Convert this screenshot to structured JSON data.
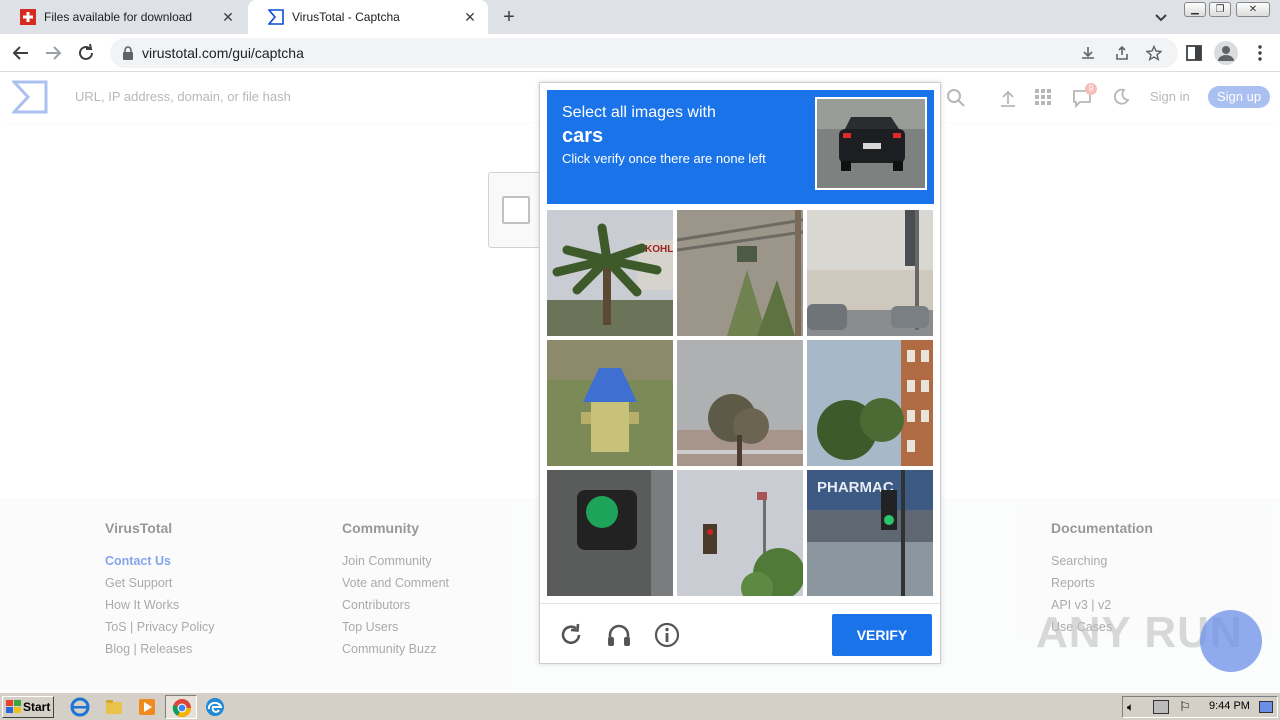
{
  "browser": {
    "tabs": [
      {
        "title": "Files available for download",
        "active": false
      },
      {
        "title": "VirusTotal - Captcha",
        "active": true
      }
    ],
    "url": "virustotal.com/gui/captcha"
  },
  "vt": {
    "search_placeholder": "URL, IP address, domain, or file hash",
    "signin": "Sign in",
    "signup": "Sign up",
    "notification_count": "9"
  },
  "footer": {
    "columns": [
      {
        "heading": "VirusTotal",
        "links": [
          "Contact Us",
          "Get Support",
          "How It Works",
          "ToS | Privacy Policy",
          "Blog | Releases"
        ]
      },
      {
        "heading": "Community",
        "links": [
          "Join Community",
          "Vote and Comment",
          "Contributors",
          "Top Users",
          "Community Buzz"
        ]
      },
      {
        "heading": "Documentation",
        "links": [
          "Searching",
          "Reports",
          "API v3 | v2",
          "Use Cases"
        ]
      }
    ]
  },
  "captcha": {
    "line1": "Select all images with",
    "target": "cars",
    "line3": "Click verify once there are none left",
    "verify_label": "VERIFY",
    "tile_text": "PHARMAC",
    "tile_sign": "KOHL"
  },
  "watermark": "ANY RUN",
  "taskbar": {
    "start_label": "Start",
    "clock": "9:44 PM"
  }
}
